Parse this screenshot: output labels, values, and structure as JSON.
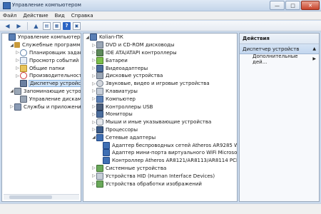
{
  "window": {
    "title": "Управление компьютером",
    "buttons": {
      "minimize": "—",
      "maximize": "□",
      "close": "✕"
    }
  },
  "menu": [
    "Файл",
    "Действие",
    "Вид",
    "Справка"
  ],
  "toolbar": {
    "back": "◀",
    "forward": "▶",
    "up": "▲",
    "show_hide": "▤",
    "properties": "▦",
    "help": "?",
    "view": "▣"
  },
  "left_tree": [
    {
      "label": "Управление компьютером (л",
      "level": 0,
      "expander": "",
      "icon": "computer-management-icon"
    },
    {
      "label": "Служебные программы",
      "level": 1,
      "expander": "◢",
      "icon": "tools-icon"
    },
    {
      "label": "Планировщик заданий",
      "level": 2,
      "expander": "▷",
      "icon": "scheduler-icon"
    },
    {
      "label": "Просмотр событий",
      "level": 2,
      "expander": "▷",
      "icon": "event-viewer-icon"
    },
    {
      "label": "Общие папки",
      "level": 2,
      "expander": "▷",
      "icon": "shared-folder-icon"
    },
    {
      "label": "Производительность",
      "level": 2,
      "expander": "▷",
      "icon": "performance-icon"
    },
    {
      "label": "Диспетчер устройств",
      "level": 2,
      "expander": "",
      "icon": "device-manager-icon",
      "selected": true
    },
    {
      "label": "Запоминающие устройств",
      "level": 1,
      "expander": "◢",
      "icon": "storage-icon"
    },
    {
      "label": "Управление дисками",
      "level": 2,
      "expander": "",
      "icon": "disk-management-icon"
    },
    {
      "label": "Службы и приложения",
      "level": 1,
      "expander": "▷",
      "icon": "services-icon"
    }
  ],
  "device_tree": [
    {
      "label": "Kolian-ПК",
      "level": 0,
      "expander": "◢",
      "icon": "computer-icon"
    },
    {
      "label": "DVD и CD-ROM дисководы",
      "level": 1,
      "expander": "▷",
      "icon": "dvd-icon"
    },
    {
      "label": "IDE ATA/ATAPI контроллеры",
      "level": 1,
      "expander": "▷",
      "icon": "ide-controller-icon"
    },
    {
      "label": "Батареи",
      "level": 1,
      "expander": "▷",
      "icon": "battery-icon"
    },
    {
      "label": "Видеоадаптеры",
      "level": 1,
      "expander": "▷",
      "icon": "display-adapter-icon"
    },
    {
      "label": "Дисковые устройства",
      "level": 1,
      "expander": "▷",
      "icon": "disk-drive-icon"
    },
    {
      "label": "Звуковые, видео и игровые устройства",
      "level": 1,
      "expander": "▷",
      "icon": "sound-icon"
    },
    {
      "label": "Клавиатуры",
      "level": 1,
      "expander": "▷",
      "icon": "keyboard-icon"
    },
    {
      "label": "Компьютер",
      "level": 1,
      "expander": "▷",
      "icon": "computer-icon"
    },
    {
      "label": "Контроллеры USB",
      "level": 1,
      "expander": "▷",
      "icon": "usb-icon"
    },
    {
      "label": "Мониторы",
      "level": 1,
      "expander": "▷",
      "icon": "monitor-icon"
    },
    {
      "label": "Мыши и иные указывающие устройства",
      "level": 1,
      "expander": "▷",
      "icon": "mouse-icon"
    },
    {
      "label": "Процессоры",
      "level": 1,
      "expander": "▷",
      "icon": "processor-icon"
    },
    {
      "label": "Сетевые адаптеры",
      "level": 1,
      "expander": "◢",
      "icon": "network-adapter-icon"
    },
    {
      "label": "Адаптер беспроводных сетей Atheros AR9285 Wirele",
      "level": 2,
      "expander": "",
      "icon": "network-adapter-icon"
    },
    {
      "label": "Адаптер мини-порта виртуального WiFi Microsoft",
      "level": 2,
      "expander": "",
      "icon": "network-adapter-icon"
    },
    {
      "label": "Контроллер Atheros AR8121/AR8113/AR8114 PCI-E E",
      "level": 2,
      "expander": "",
      "icon": "network-adapter-icon"
    },
    {
      "label": "Системные устройства",
      "level": 1,
      "expander": "▷",
      "icon": "system-device-icon"
    },
    {
      "label": "Устройства HID (Human Interface Devices)",
      "level": 1,
      "expander": "▷",
      "icon": "hid-icon"
    },
    {
      "label": "Устройства обработки изображений",
      "level": 1,
      "expander": "▷",
      "icon": "imaging-icon"
    }
  ],
  "actions": {
    "header": "Действия",
    "section": "Диспетчер устройств",
    "section_caret": "▲",
    "item": "Дополнительные дей...",
    "item_caret": "▶"
  }
}
